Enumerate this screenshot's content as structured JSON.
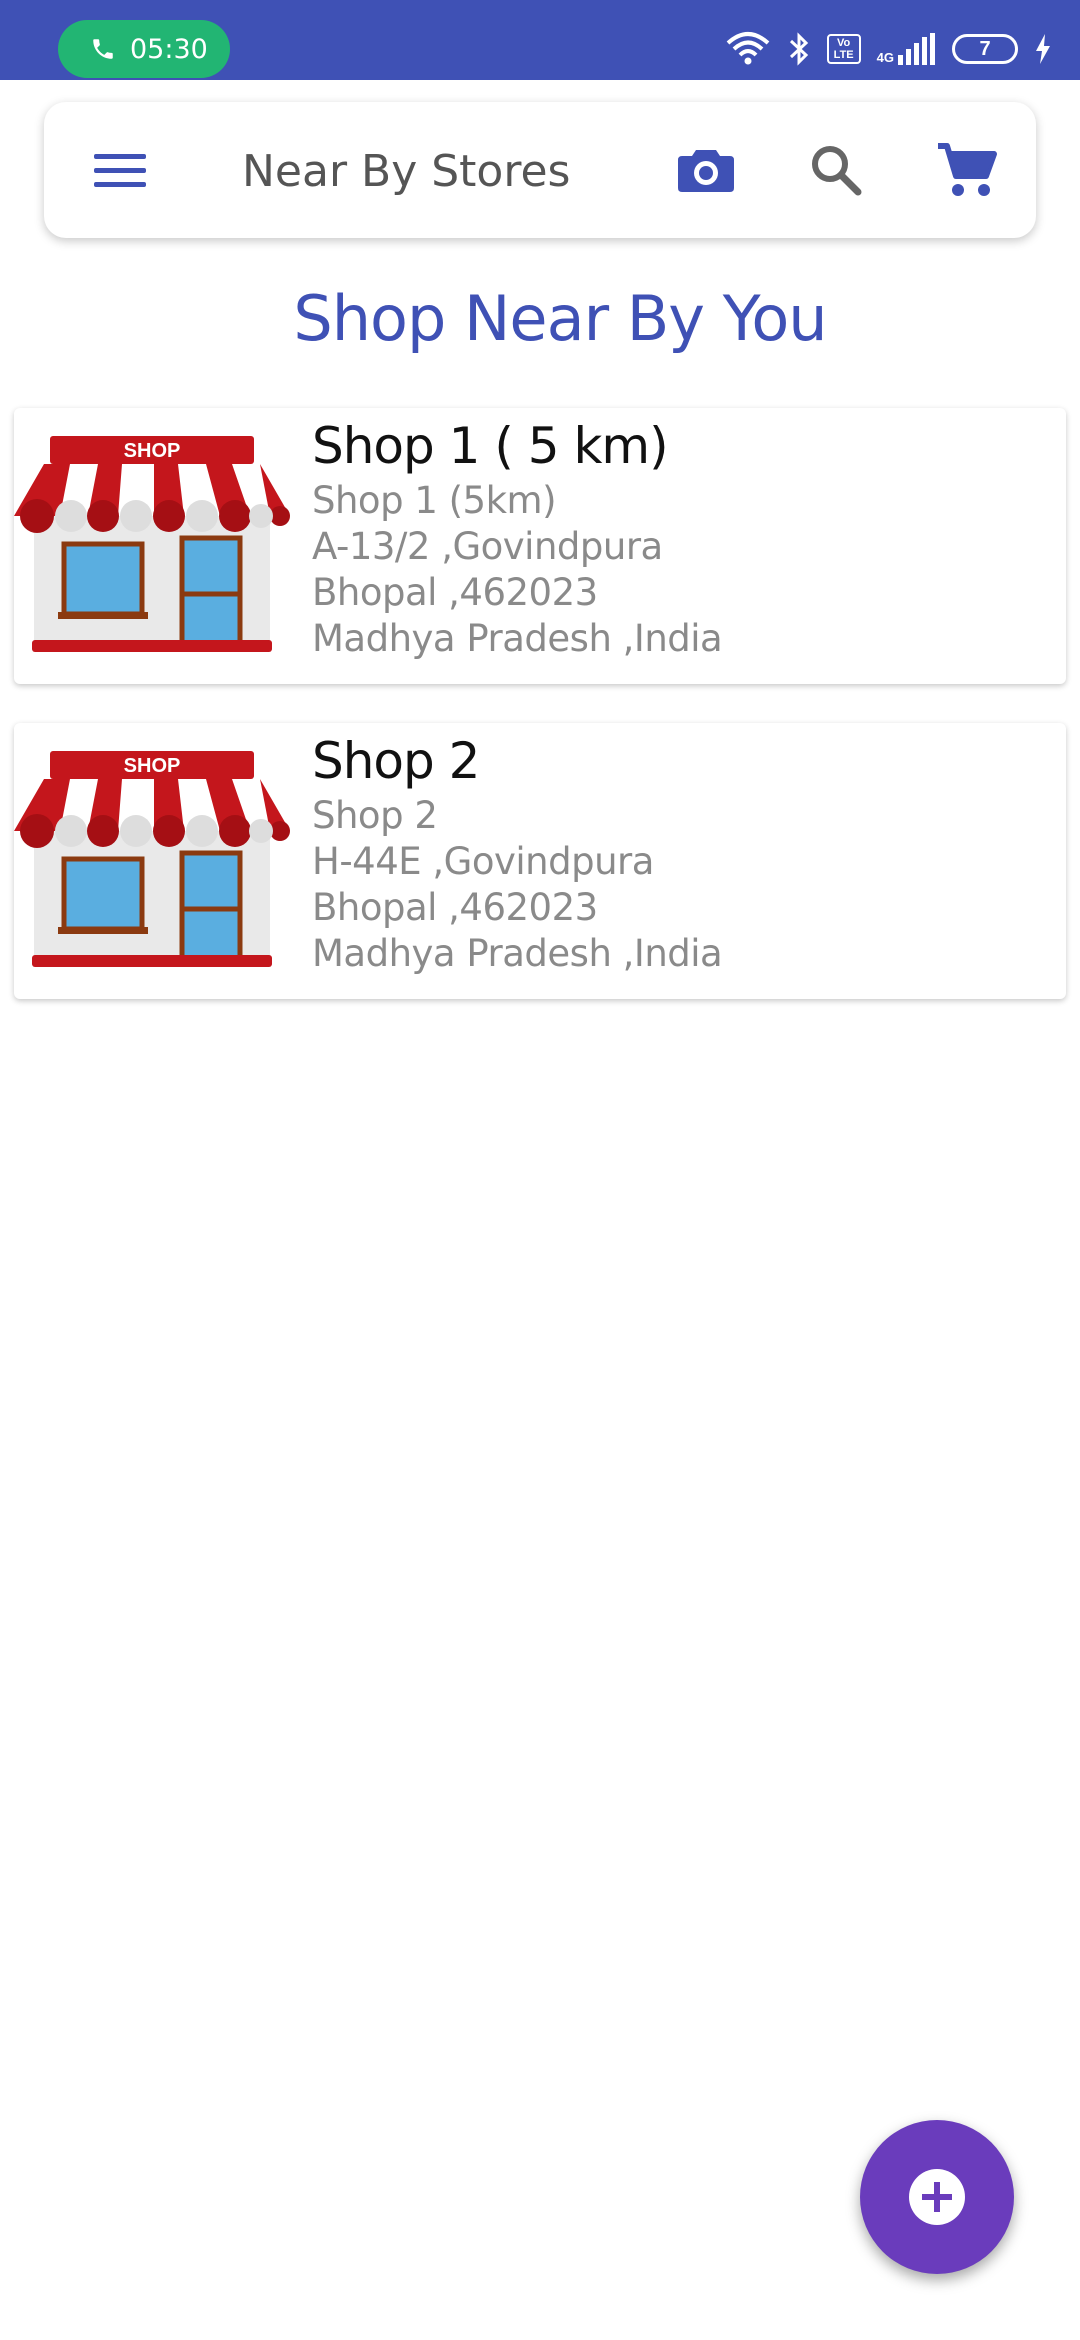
{
  "status_bar": {
    "call_time": "05:30",
    "network": "4G",
    "volte_label": "Vo\nLTE",
    "battery_level": "7",
    "icons": [
      "phone-icon",
      "wifi-icon",
      "bluetooth-icon",
      "volte-icon",
      "signal-icon",
      "battery-icon",
      "charging-icon"
    ]
  },
  "app_bar": {
    "title": "Near By Stores",
    "icons": [
      "menu-icon",
      "camera-icon",
      "search-icon",
      "cart-icon"
    ]
  },
  "heading": "Shop Near By You",
  "shops": [
    {
      "name": "Shop 1 ( 5 km)",
      "subtitle": "Shop 1 (5km)",
      "address": "A-13/2 ,Govindpura",
      "city": "Bhopal ,462023",
      "state": "Madhya Pradesh ,India",
      "sign": "SHOP"
    },
    {
      "name": "Shop 2",
      "subtitle": "Shop 2",
      "address": "H-44E ,Govindpura",
      "city": "Bhopal ,462023",
      "state": "Madhya Pradesh ,India",
      "sign": "SHOP"
    }
  ],
  "fab": {
    "icon": "add-icon"
  },
  "colors": {
    "primary": "#3f51b5",
    "call_pill": "#22b573",
    "fab": "#6a3cbc",
    "awning_red": "#c4161c"
  }
}
